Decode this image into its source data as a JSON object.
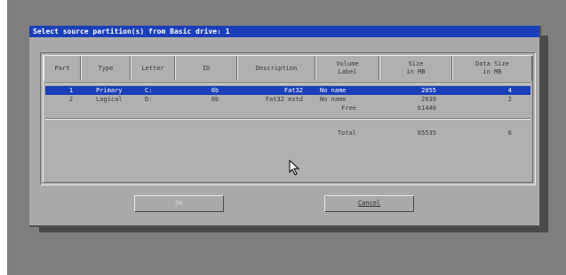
{
  "dialog": {
    "title": "Select source partition(s) from Basic drive: 1"
  },
  "table": {
    "headers": [
      {
        "line1": "Part",
        "line2": ""
      },
      {
        "line1": "Type",
        "line2": ""
      },
      {
        "line1": "Letter",
        "line2": ""
      },
      {
        "line1": "ID",
        "line2": ""
      },
      {
        "line1": "Description",
        "line2": ""
      },
      {
        "line1": "Volume",
        "line2": "Label"
      },
      {
        "line1": "Size",
        "line2": "in MB"
      },
      {
        "line1": "Data Size",
        "line2": "in MB"
      }
    ],
    "rows": [
      {
        "part": "1",
        "type": "Primary",
        "letter": "C:",
        "id": "0b",
        "description": "Fat32",
        "label": "No name",
        "size": "2055",
        "data_size": "4"
      },
      {
        "part": "2",
        "type": "Logical",
        "letter": "D:",
        "id": "0b",
        "description": "Fat32 extd",
        "label": "No name",
        "size": "2039",
        "data_size": "2"
      },
      {
        "part": "",
        "type": "",
        "letter": "",
        "id": "",
        "description": "",
        "label": "Free",
        "size": "61440",
        "data_size": ""
      }
    ],
    "total": {
      "label": "Total",
      "size": "65535",
      "data_size": "6"
    }
  },
  "buttons": {
    "ok_label": "OK",
    "cancel_label": "Cancel"
  },
  "colors": {
    "titlebar": "#1a3fb8",
    "selection": "#1a3fb8",
    "dialog_bg": "#a9a9a9",
    "desktop": "#7f7f7f"
  }
}
